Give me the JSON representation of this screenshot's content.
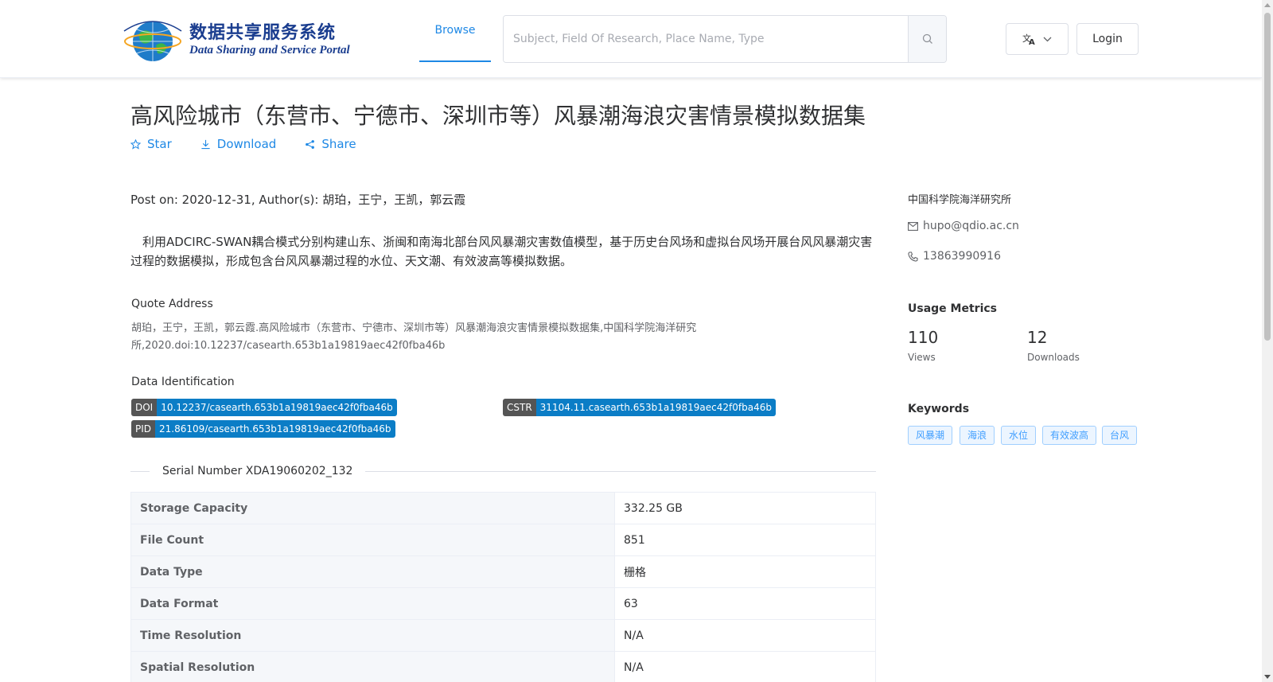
{
  "header": {
    "logo_cn": "数据共享服务系统",
    "logo_en": "Data Sharing and Service Portal",
    "nav_browse": "Browse",
    "search_placeholder": "Subject, Field Of Research, Place Name, Type",
    "login_label": "Login"
  },
  "dataset": {
    "title": "高风险城市（东营市、宁德市、深圳市等）风暴潮海浪灾害情景模拟数据集",
    "actions": {
      "star": "Star",
      "download": "Download",
      "share": "Share"
    },
    "meta": "Post on: 2020-12-31, Author(s): 胡珀，王宁，王凯，郭云霞",
    "abstract": "利用ADCIRC-SWAN耦合模式分别构建山东、浙闽和南海北部台风风暴潮灾害数值模型，基于历史台风场和虚拟台风场开展台风风暴潮灾害过程的数据模拟，形成包含台风风暴潮过程的水位、天文潮、有效波高等模拟数据。",
    "quote_label": "Quote Address",
    "quote_text": "胡珀，王宁，王凯，郭云霞.高风险城市（东营市、宁德市、深圳市等）风暴潮海浪灾害情景模拟数据集,中国科学院海洋研究所,2020.doi:10.12237/casearth.653b1a19819aec42f0fba46b",
    "identification_label": "Data Identification",
    "identifiers": {
      "doi_key": "DOI",
      "doi_val": "10.12237/casearth.653b1a19819aec42f0fba46b",
      "cstr_key": "CSTR",
      "cstr_val": "31104.11.casearth.653b1a19819aec42f0fba46b",
      "pid_key": "PID",
      "pid_val": "21.86109/casearth.653b1a19819aec42f0fba46b"
    },
    "serial_number": "Serial Number XDA19060202_132",
    "table": [
      {
        "key": "Storage Capacity",
        "value": "332.25 GB"
      },
      {
        "key": "File Count",
        "value": "851"
      },
      {
        "key": "Data Type",
        "value": "栅格"
      },
      {
        "key": "Data Format",
        "value": "63"
      },
      {
        "key": "Time Resolution",
        "value": "N/A"
      },
      {
        "key": "Spatial Resolution",
        "value": "N/A"
      }
    ]
  },
  "sidebar": {
    "org": "中国科学院海洋研究所",
    "email": "hupo@qdio.ac.cn",
    "phone": "13863990916",
    "usage_title": "Usage Metrics",
    "views_num": "110",
    "views_label": "Views",
    "downloads_num": "12",
    "downloads_label": "Downloads",
    "keywords_title": "Keywords",
    "keywords": [
      "风暴潮",
      "海浪",
      "水位",
      "有效波高",
      "台风"
    ]
  },
  "colors": {
    "accent": "#1e88e5",
    "tag_value": "#0b7dc6",
    "tag_key": "#555555",
    "logo_blue": "#1a3d8f"
  }
}
